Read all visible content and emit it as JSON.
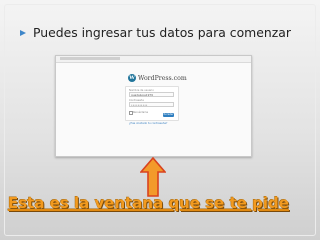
{
  "slide": {
    "bullet_text": "Puedes ingresar tus datos para comenzar",
    "caption": "Esta es la ventana que se te pide"
  },
  "screenshot": {
    "logo_text": "WordPress.com",
    "username_label": "Nombre de usuario",
    "username_value": "guadalupe1979",
    "password_label": "Contraseña",
    "password_value": "••••••••••",
    "remember_label": "Recuérdame",
    "login_button": "Acceder",
    "lost_password": "¿Has olvidado tu contraseña?"
  },
  "colors": {
    "accent": "#3e86c9",
    "caption": "#f29a1f",
    "arrow_fill": "#f39a2a",
    "arrow_stroke": "#d9431e"
  }
}
